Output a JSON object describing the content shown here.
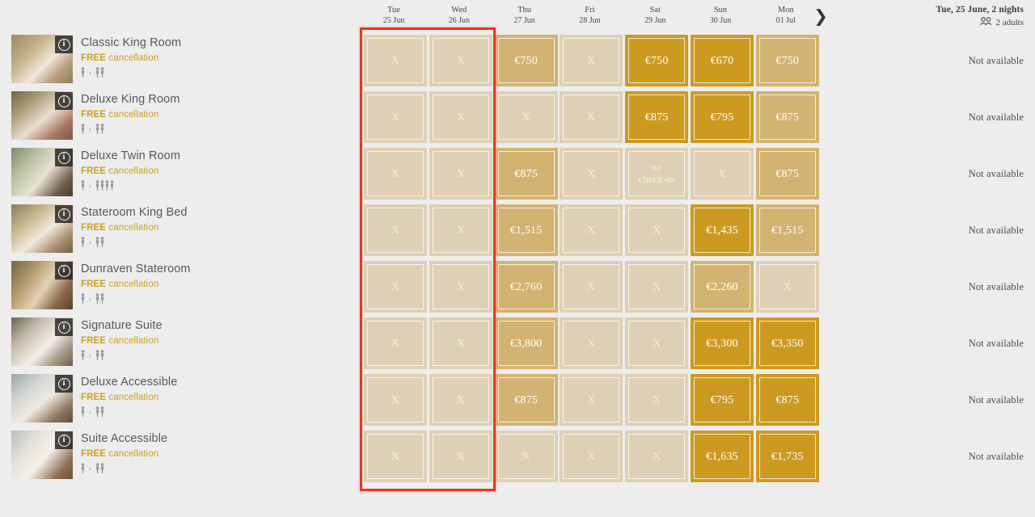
{
  "summary": {
    "stay": "Tue, 25 June, 2 nights",
    "guests": "2 adults",
    "guests_icon": "people-icon",
    "next_arrow_icon": "chevron-right-icon"
  },
  "calendar": {
    "columns": [
      {
        "dow": "Tue",
        "date": "25 Jun"
      },
      {
        "dow": "Wed",
        "date": "26 Jun"
      },
      {
        "dow": "Thu",
        "date": "27 Jun"
      },
      {
        "dow": "Fri",
        "date": "28 Jun"
      },
      {
        "dow": "Sat",
        "date": "29 Jun"
      },
      {
        "dow": "Sun",
        "date": "30 Jun"
      },
      {
        "dow": "Mon",
        "date": "01 Jul"
      }
    ],
    "selection": {
      "from": "Tue 25 Jun",
      "to": "Wed 26 Jun",
      "color": "#e8361c"
    }
  },
  "legend_colors": {
    "unavailable": "#ded0b5",
    "mid_rate": "#d3b371",
    "high_rate": "#cd9a21",
    "page_background": "#ededed",
    "free_cancellation_text": "#c9a227"
  },
  "labels": {
    "unavailable_mark": "X",
    "no_checkin": "no\ncheck-in",
    "not_available": "Not available",
    "free": "FREE",
    "cancellation": "cancellation",
    "occupancy_separator": "›",
    "info_glyph": "i"
  },
  "rooms": [
    {
      "name": "Classic King Room",
      "cancellation_free": "FREE",
      "cancellation_rest": "cancellation",
      "occupancy_from": 1,
      "occupancy_to": 2,
      "right_status": "Not available",
      "cells": [
        {
          "label": "X",
          "state": "unavail"
        },
        {
          "label": "X",
          "state": "unavail"
        },
        {
          "label": "€750",
          "state": "mid"
        },
        {
          "label": "X",
          "state": "unavail"
        },
        {
          "label": "€750",
          "state": "high"
        },
        {
          "label": "€670",
          "state": "high"
        },
        {
          "label": "€750",
          "state": "mid"
        }
      ]
    },
    {
      "name": "Deluxe King Room",
      "cancellation_free": "FREE",
      "cancellation_rest": "cancellation",
      "occupancy_from": 1,
      "occupancy_to": 2,
      "right_status": "Not available",
      "cells": [
        {
          "label": "X",
          "state": "unavail"
        },
        {
          "label": "X",
          "state": "unavail"
        },
        {
          "label": "X",
          "state": "unavail"
        },
        {
          "label": "X",
          "state": "unavail"
        },
        {
          "label": "€875",
          "state": "high"
        },
        {
          "label": "€795",
          "state": "high"
        },
        {
          "label": "€875",
          "state": "mid"
        }
      ]
    },
    {
      "name": "Deluxe Twin Room",
      "cancellation_free": "FREE",
      "cancellation_rest": "cancellation",
      "occupancy_from": 1,
      "occupancy_to": 4,
      "right_status": "Not available",
      "cells": [
        {
          "label": "X",
          "state": "unavail"
        },
        {
          "label": "X",
          "state": "unavail"
        },
        {
          "label": "€875",
          "state": "mid"
        },
        {
          "label": "X",
          "state": "unavail"
        },
        {
          "label": "no check-in",
          "state": "nocheck"
        },
        {
          "label": "X",
          "state": "unavail"
        },
        {
          "label": "€875",
          "state": "mid"
        }
      ]
    },
    {
      "name": "Stateroom King Bed",
      "cancellation_free": "FREE",
      "cancellation_rest": "cancellation",
      "occupancy_from": 1,
      "occupancy_to": 2,
      "right_status": "Not available",
      "cells": [
        {
          "label": "X",
          "state": "unavail"
        },
        {
          "label": "X",
          "state": "unavail"
        },
        {
          "label": "€1,515",
          "state": "mid"
        },
        {
          "label": "X",
          "state": "unavail"
        },
        {
          "label": "X",
          "state": "unavail"
        },
        {
          "label": "€1,435",
          "state": "high"
        },
        {
          "label": "€1,515",
          "state": "mid"
        }
      ]
    },
    {
      "name": "Dunraven Stateroom",
      "cancellation_free": "FREE",
      "cancellation_rest": "cancellation",
      "occupancy_from": 1,
      "occupancy_to": 2,
      "right_status": "Not available",
      "cells": [
        {
          "label": "X",
          "state": "unavail"
        },
        {
          "label": "X",
          "state": "unavail"
        },
        {
          "label": "€2,760",
          "state": "mid"
        },
        {
          "label": "X",
          "state": "unavail"
        },
        {
          "label": "X",
          "state": "unavail"
        },
        {
          "label": "€2,260",
          "state": "mid"
        },
        {
          "label": "X",
          "state": "unavail"
        }
      ]
    },
    {
      "name": "Signature Suite",
      "cancellation_free": "FREE",
      "cancellation_rest": "cancellation",
      "occupancy_from": 1,
      "occupancy_to": 2,
      "right_status": "Not available",
      "cells": [
        {
          "label": "X",
          "state": "unavail"
        },
        {
          "label": "X",
          "state": "unavail"
        },
        {
          "label": "€3,800",
          "state": "mid"
        },
        {
          "label": "X",
          "state": "unavail"
        },
        {
          "label": "X",
          "state": "unavail"
        },
        {
          "label": "€3,300",
          "state": "high"
        },
        {
          "label": "€3,350",
          "state": "high"
        }
      ]
    },
    {
      "name": "Deluxe Accessible",
      "cancellation_free": "FREE",
      "cancellation_rest": "cancellation",
      "occupancy_from": 1,
      "occupancy_to": 2,
      "right_status": "Not available",
      "cells": [
        {
          "label": "X",
          "state": "unavail"
        },
        {
          "label": "X",
          "state": "unavail"
        },
        {
          "label": "€875",
          "state": "mid"
        },
        {
          "label": "X",
          "state": "unavail"
        },
        {
          "label": "X",
          "state": "unavail"
        },
        {
          "label": "€795",
          "state": "high"
        },
        {
          "label": "€875",
          "state": "high"
        }
      ]
    },
    {
      "name": "Suite Accessible",
      "cancellation_free": "FREE",
      "cancellation_rest": "cancellation",
      "occupancy_from": 1,
      "occupancy_to": 2,
      "right_status": "Not available",
      "cells": [
        {
          "label": "X",
          "state": "unavail"
        },
        {
          "label": "X",
          "state": "unavail"
        },
        {
          "label": "X",
          "state": "unavail"
        },
        {
          "label": "X",
          "state": "unavail"
        },
        {
          "label": "X",
          "state": "unavail"
        },
        {
          "label": "€1,635",
          "state": "high"
        },
        {
          "label": "€1,735",
          "state": "high"
        }
      ]
    }
  ]
}
